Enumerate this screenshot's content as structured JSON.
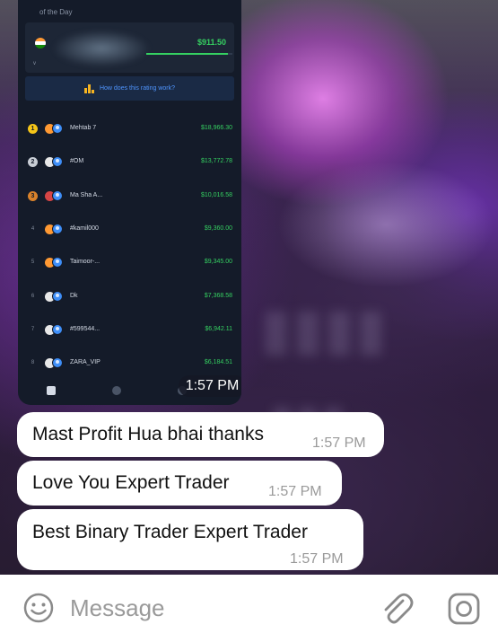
{
  "leaderboard": {
    "caption": "of the Day",
    "my_entry": {
      "amount": "$911.50",
      "progress_fraction": 0.95
    },
    "rating_link": "How does this rating work?",
    "rows": [
      {
        "rank": "1",
        "badge_color": "#f5c518",
        "flag": "#ff9933",
        "name": "Mehtab 7",
        "amount": "$18,966.30"
      },
      {
        "rank": "2",
        "badge_color": "#c9ced6",
        "flag": "#e8e8e8",
        "name": "#OM",
        "amount": "$13,772.78"
      },
      {
        "rank": "3",
        "badge_color": "#d9822b",
        "flag": "#d64545",
        "name": "Ma Sha A...",
        "amount": "$10,016.58"
      },
      {
        "rank": "4",
        "badge_color": "",
        "flag": "#ff9933",
        "name": "#kamil000",
        "amount": "$9,360.00"
      },
      {
        "rank": "5",
        "badge_color": "",
        "flag": "#ff9933",
        "name": "Taimoor-...",
        "amount": "$9,345.00"
      },
      {
        "rank": "6",
        "badge_color": "",
        "flag": "#e8e8e8",
        "name": "Dk",
        "amount": "$7,368.58"
      },
      {
        "rank": "7",
        "badge_color": "",
        "flag": "#e8e8e8",
        "name": "#599544...",
        "amount": "$6,942.11"
      },
      {
        "rank": "8",
        "badge_color": "",
        "flag": "#e8e8e8",
        "name": "ZARA_VIP",
        "amount": "$6,184.51"
      }
    ],
    "photo_time": "1:57 PM"
  },
  "messages": [
    {
      "text": "Mast Profit Hua bhai thanks",
      "time": "1:57 PM"
    },
    {
      "text": "Love You Expert Trader",
      "time": "1:57 PM"
    },
    {
      "text": "Best Binary Trader Expert Trader",
      "time": "1:57 PM"
    }
  ],
  "composer": {
    "placeholder": "Message"
  },
  "icons": {
    "emoji": "emoji-icon",
    "attach": "paperclip-icon",
    "camera": "camera-icon"
  },
  "colors": {
    "bubble": "#ffffff",
    "profit_green": "#35d061",
    "link_blue": "#4f95ff"
  }
}
